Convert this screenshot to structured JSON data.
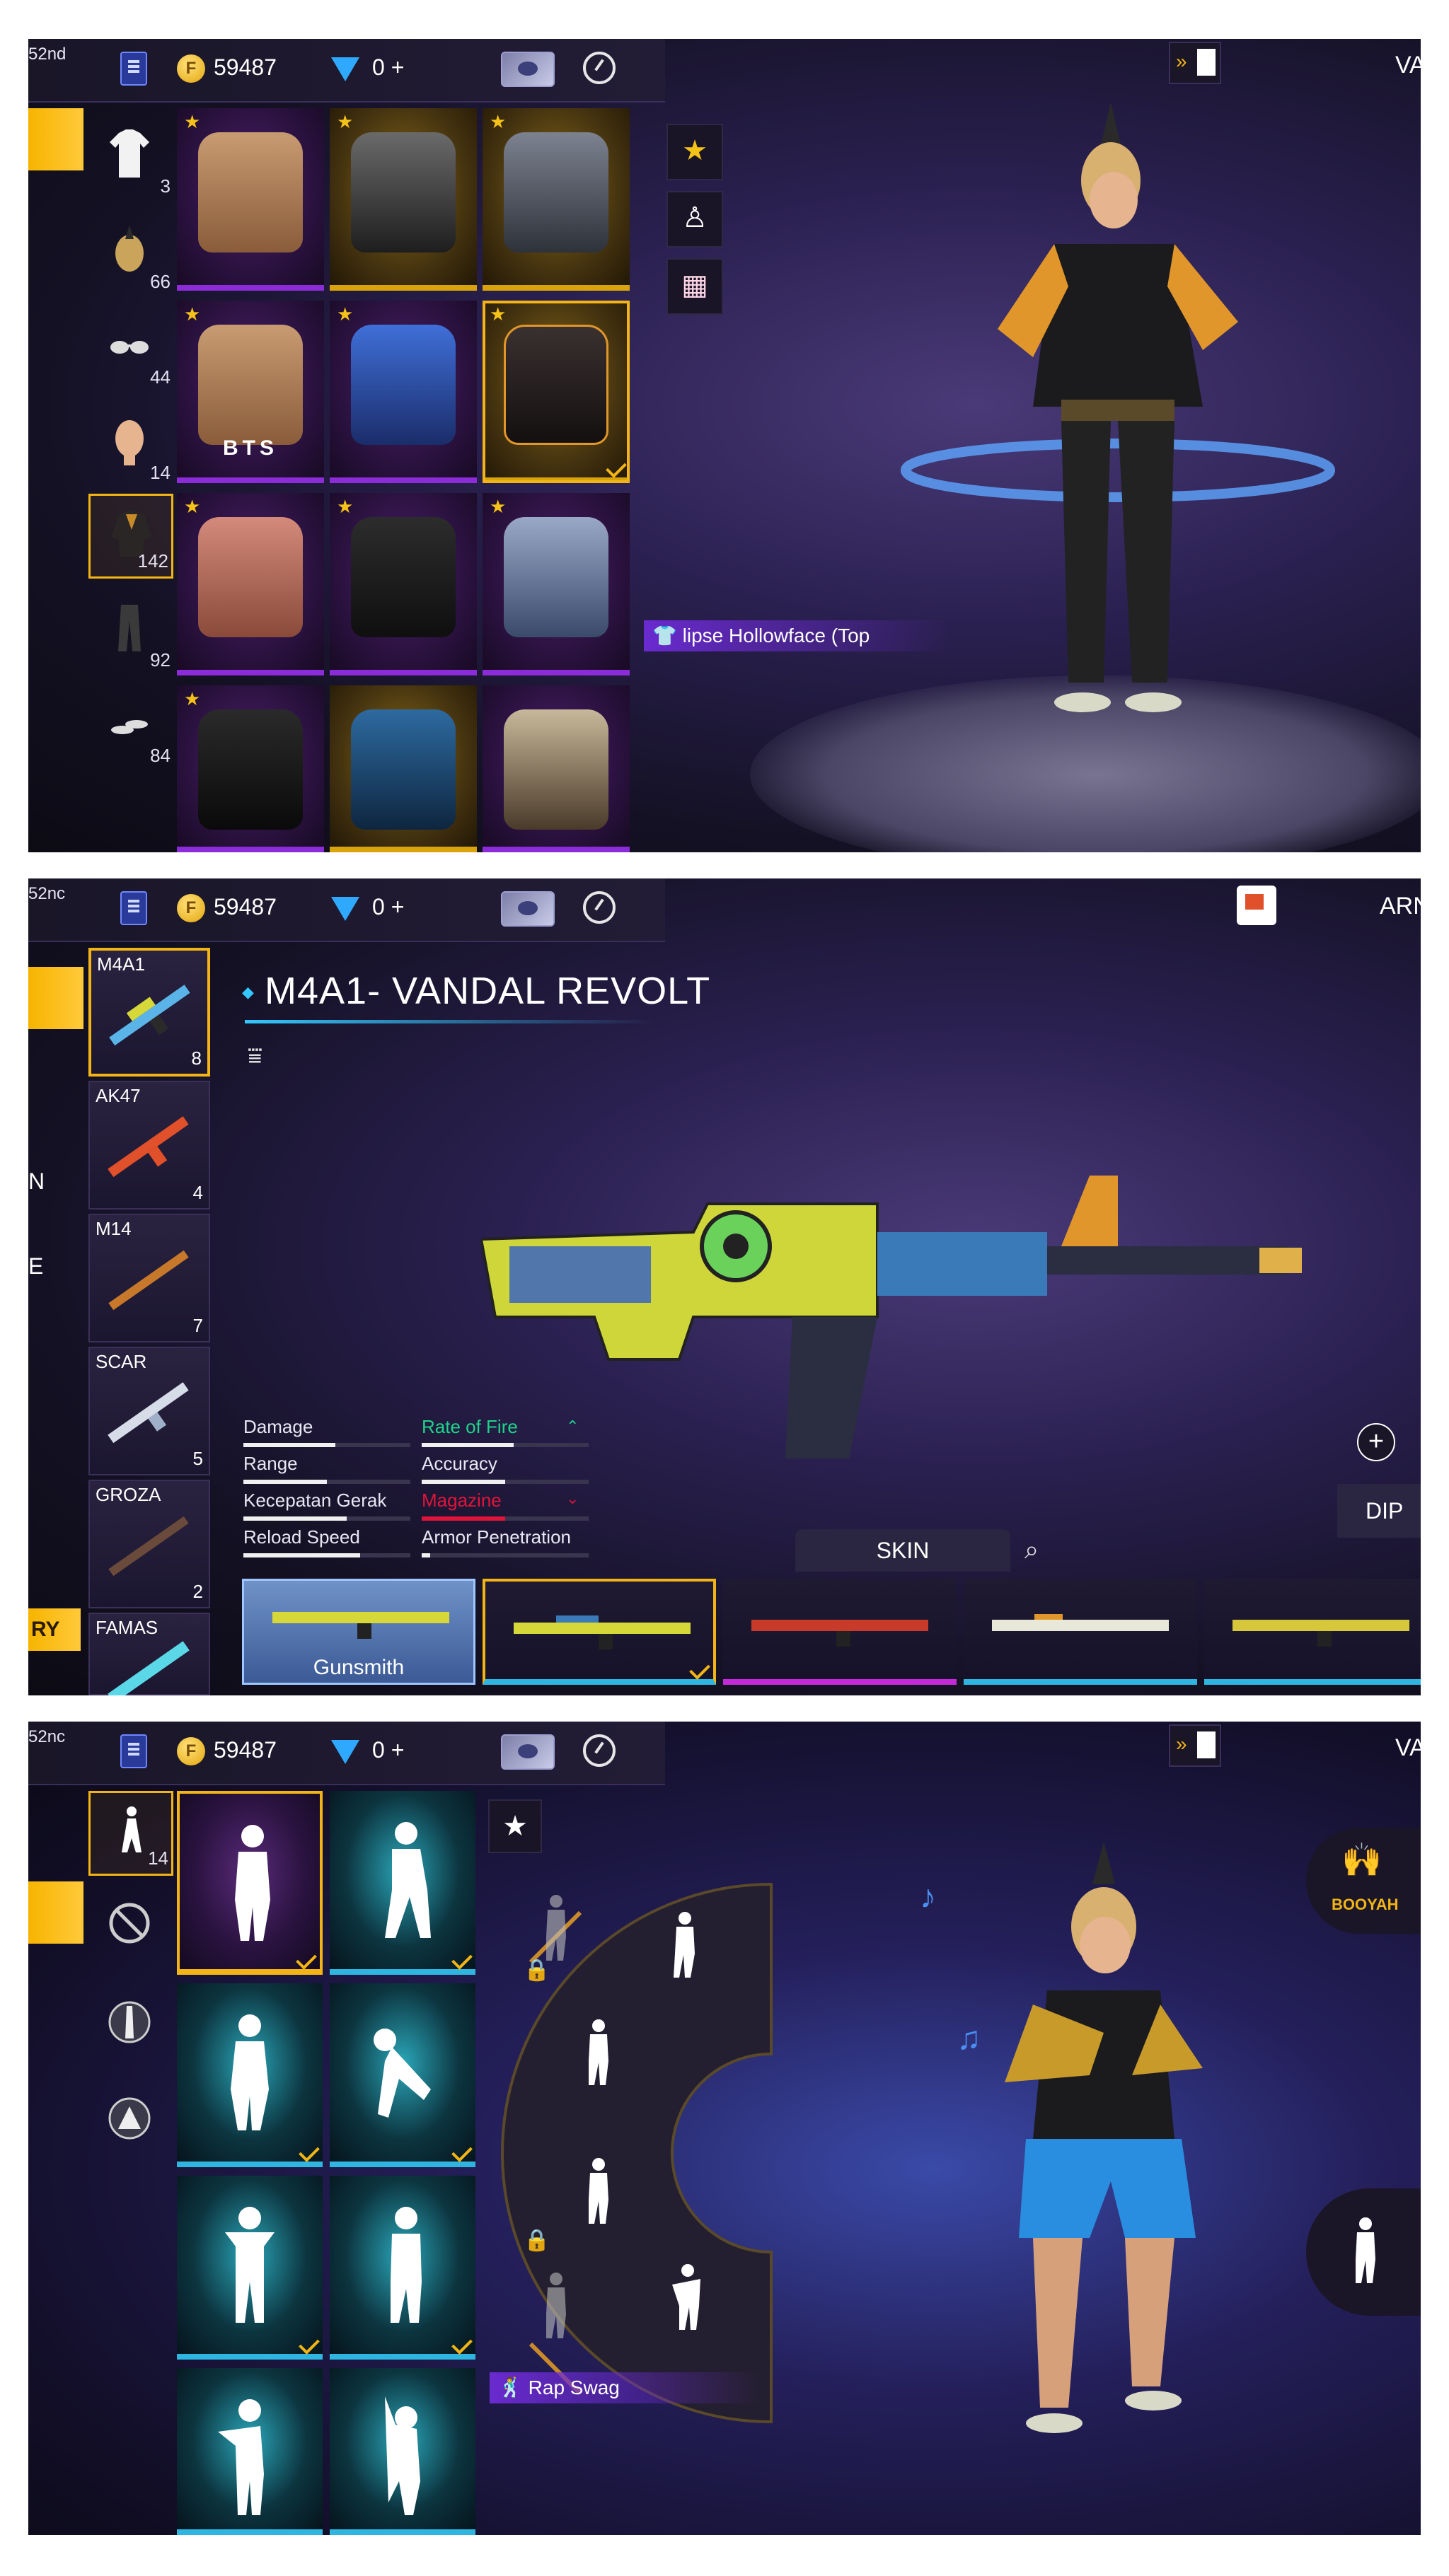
{
  "panel1": {
    "rank": "52nd",
    "coins": "59487",
    "diamonds": "0",
    "plus": "+",
    "right_label": "VA",
    "categories": [
      {
        "count": "3",
        "icon": "shirt-icon"
      },
      {
        "count": "66",
        "icon": "hair-icon"
      },
      {
        "count": "44",
        "icon": "glasses-icon"
      },
      {
        "count": "14",
        "icon": "face-icon"
      },
      {
        "count": "142",
        "icon": "top-icon"
      },
      {
        "count": "92",
        "icon": "pants-icon"
      },
      {
        "count": "84",
        "icon": "shoes-icon"
      }
    ],
    "tile_label_bts": "BTS",
    "item_name": "lipse Hollowface (Top"
  },
  "panel2": {
    "rank": "52nc",
    "coins": "59487",
    "diamonds": "0",
    "plus": "+",
    "right_label": "ARN",
    "weapons": [
      {
        "name": "M4A1",
        "count": "8"
      },
      {
        "name": "AK47",
        "count": "4"
      },
      {
        "name": "M14",
        "count": "7"
      },
      {
        "name": "SCAR",
        "count": "5"
      },
      {
        "name": "GROZA",
        "count": "2"
      },
      {
        "name": "FAMAS",
        "count": ""
      }
    ],
    "side_left_letters": [
      "N",
      "E"
    ],
    "side_tab_text": "RY",
    "title": "M4A1- VANDAL REVOLT",
    "stats": [
      {
        "label": "Damage",
        "value": 0.55
      },
      {
        "label": "Range",
        "value": 0.5
      },
      {
        "label": "Kecepatan Gerak",
        "value": 0.62
      },
      {
        "label": "Reload Speed",
        "value": 0.7
      }
    ],
    "stats_right": [
      {
        "label": "Rate of Fire",
        "value": 0.55,
        "color": "#1fd38a"
      },
      {
        "label": "Accuracy",
        "value": 0.5,
        "color": "#e8e6f2"
      },
      {
        "label": "Magazine",
        "value": 0.5,
        "color": "#e0143a"
      },
      {
        "label": "Armor Penetration",
        "value": 0.05,
        "color": "#e8e6f2"
      }
    ],
    "skin_tab": "SKIN",
    "gunsmith": "Gunsmith",
    "right_button": "DIP"
  },
  "panel3": {
    "rank": "52nc",
    "coins": "59487",
    "diamonds": "0",
    "plus": "+",
    "right_label": "VA",
    "emote_count": "14",
    "emote_name": "Rap Swag",
    "booyah": "BOOYAH"
  },
  "colors": {
    "accent_gold": "#f2b515",
    "purple_rarity": "#8c2bd8",
    "blue_rarity": "#2fb6e0"
  }
}
